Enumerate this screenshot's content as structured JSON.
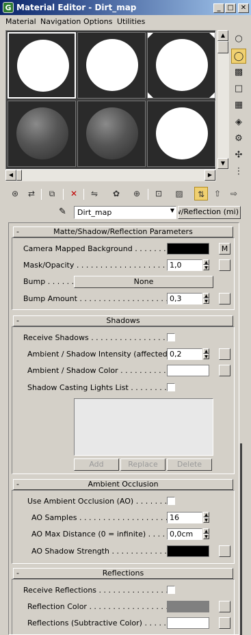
{
  "window": {
    "title": "Material Editor - Dirt_map",
    "app_icon": "3ds-max-icon",
    "minimize": "_",
    "maximize": "□",
    "close": "✕"
  },
  "menu": [
    {
      "label": "Material",
      "accel": "M"
    },
    {
      "label": "Navigation",
      "accel": "N"
    },
    {
      "label": "Options",
      "accel": "O"
    },
    {
      "label": "Utilities",
      "accel": "U"
    }
  ],
  "toolbar": {
    "material_name": "Dirt_map",
    "type_button": "w/Reflection (mi)"
  },
  "matte": {
    "title": "Matte/Shadow/Reflection Parameters",
    "camera_bg_label": "Camera Mapped Background . . . . . . . . .",
    "camera_bg_color": "#000000",
    "camera_bg_map": "M",
    "mask_label": "Mask/Opacity . . . . . . . . . . . . . . . . . . . . .",
    "mask_value": "1,0",
    "bump_label": "Bump . . . . . .",
    "bump_map": "None",
    "bump_amount_label": "Bump Amount . . . . . . . . . . . . . . . . . . . .",
    "bump_amount_value": "0,3"
  },
  "shadows": {
    "title": "Shadows",
    "receive_label": "Receive Shadows . . . . . . . . . . . . . . . . .",
    "ambient_intensity_label": "Ambient / Shadow Intensity (affected b...",
    "ambient_intensity_value": "0,2",
    "ambient_color_label": "Ambient / Shadow Color . . . . . . . . . . . .",
    "ambient_color": "#ffffff",
    "lights_label": "Shadow Casting Lights List . . . . . . . . . .",
    "add": "Add",
    "replace": "Replace",
    "delete": "Delete"
  },
  "ao": {
    "title": "Ambient Occlusion",
    "use_label": "Use Ambient Occlusion (AO) . . . . . . . . .",
    "samples_label": "AO Samples . . . . . . . . . . . . . . . . . . . .",
    "samples_value": "16",
    "max_distance_label": "AO Max Distance (0 = infinite) . . . . . . .",
    "max_distance_value": "0,0cm",
    "strength_label": "AO Shadow Strength . . . . . . . . . . . . . .",
    "strength_color": "#000000"
  },
  "reflections": {
    "title": "Reflections",
    "receive_label": "Receive Reflections . . . . . . . . . . . . . . .",
    "color_label": "Reflection Color . . . . . . . . . . . . . . . . . .",
    "color": "#808080",
    "subtractive_label": "Reflections (Subtractive Color) . . . . . . . .",
    "subtractive_color": "#ffffff"
  },
  "rollout_minus": "-",
  "spin_up": "▲",
  "spin_down": "▼"
}
